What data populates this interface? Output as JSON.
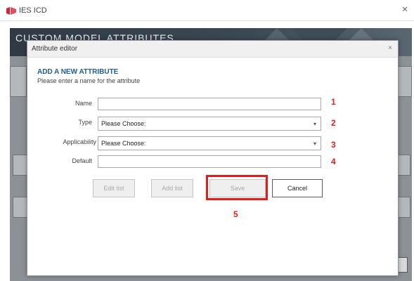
{
  "app": {
    "title": "IES ICD",
    "close_glyph": "×",
    "header_title": "CUSTOM MODEL ATTRIBUTES"
  },
  "dialog": {
    "title": "Attribute editor",
    "close_glyph": "×",
    "heading": "ADD A NEW ATTRIBUTE",
    "subheading": "Please enter a name for the attribute",
    "fields": {
      "name": {
        "label": "Name",
        "value": "",
        "marker": "1"
      },
      "type": {
        "label": "Type",
        "value": "Please Choose:",
        "marker": "2"
      },
      "applicability": {
        "label": "Applicability",
        "value": "Please Choose:",
        "marker": "3"
      },
      "default": {
        "label": "Default",
        "value": "",
        "marker": "4"
      }
    },
    "buttons": {
      "edit_list": "Edit list",
      "add_list": "Add list",
      "save": "Save",
      "cancel": "Cancel"
    },
    "save_marker": "5"
  },
  "colors": {
    "marker": "#d22222",
    "heading": "#1f5d8f",
    "highlight": "#e11d1d"
  },
  "icons": {
    "logo": "ies-logo-icon",
    "dropdown": "chevron-down-icon",
    "close": "close-icon"
  }
}
